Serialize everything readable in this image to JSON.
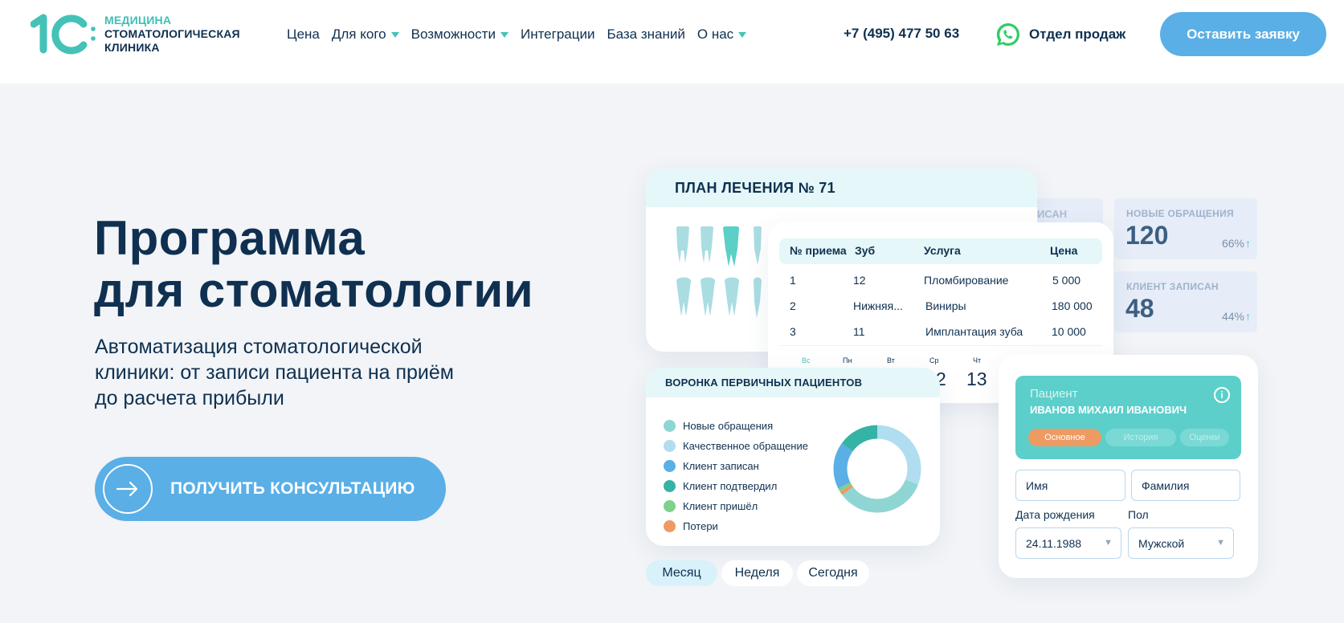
{
  "header": {
    "logo": {
      "brand": "1С",
      "line1": "МЕДИЦИНА",
      "line2": "СТОМАТОЛОГИЧЕСКАЯ",
      "line3": "КЛИНИКА"
    },
    "nav": [
      {
        "label": "Цена",
        "dropdown": false
      },
      {
        "label": "Для кого",
        "dropdown": true
      },
      {
        "label": "Возможности",
        "dropdown": true
      },
      {
        "label": "Интеграции",
        "dropdown": false
      },
      {
        "label": "База знаний",
        "dropdown": false
      },
      {
        "label": "О нас",
        "dropdown": true
      }
    ],
    "phone": "+7 (495) 477 50 63",
    "sales_label": "Отдел продаж",
    "cta_label": "Оставить заявку"
  },
  "hero": {
    "title_line1": "Программа",
    "title_line2": "для стоматологии",
    "subtitle_line1": "Автоматизация стоматологической",
    "subtitle_line2": "клиники: от записи пациента на приём",
    "subtitle_line3": "до расчета прибыли",
    "cta_label": "ПОЛУЧИТЬ КОНСУЛЬТАЦИЮ"
  },
  "dashboard": {
    "plan_title": "ПЛАН ЛЕЧЕНИЯ № 71",
    "back_card_label": "ИСАН",
    "stats": [
      {
        "label": "НОВЫЕ ОБРАЩЕНИЯ",
        "value": "120",
        "pct": "66%"
      },
      {
        "label": "КЛИЕНТ ЗАПИСАН",
        "value": "48",
        "pct": "44%"
      }
    ],
    "table": {
      "headers": [
        "№ приема",
        "Зуб",
        "Услуга",
        "Цена"
      ],
      "rows": [
        [
          "1",
          "12",
          "Пломбирование",
          "5 000"
        ],
        [
          "2",
          "Нижняя...",
          "Виниры",
          "180 000"
        ],
        [
          "3",
          "11",
          "Имплантация зуба",
          "10 000"
        ]
      ],
      "days": [
        "Вс",
        "Пн",
        "Вт",
        "Ср",
        "Чт"
      ],
      "numbers": [
        "2",
        "13"
      ]
    },
    "funnel": {
      "title": "ВОРОНКА ПЕРВИЧНЫХ ПАЦИЕНТОВ",
      "legend": [
        {
          "label": "Новые обращения",
          "color": "#8fd5d3"
        },
        {
          "label": "Качественное обращение",
          "color": "#b0ddf0"
        },
        {
          "label": "Клиент записан",
          "color": "#5aafe6"
        },
        {
          "label": "Клиент подтвердил",
          "color": "#35b3a4"
        },
        {
          "label": "Клиент пришёл",
          "color": "#7fd08a"
        },
        {
          "label": "Потери",
          "color": "#ee9a63"
        }
      ]
    },
    "periods": [
      "Месяц",
      "Неделя",
      "Сегодня"
    ],
    "patient": {
      "label": "Пациент",
      "name": "ИВАНОВ МИХАИЛ ИВАНОВИЧ",
      "tabs": [
        "Основное",
        "История",
        "Оценки"
      ],
      "first_name_placeholder": "Имя",
      "last_name_placeholder": "Фамилия",
      "birth_label": "Дата рождения",
      "birth_value": "24.11.1988",
      "sex_label": "Пол",
      "sex_value": "Мужской"
    }
  }
}
